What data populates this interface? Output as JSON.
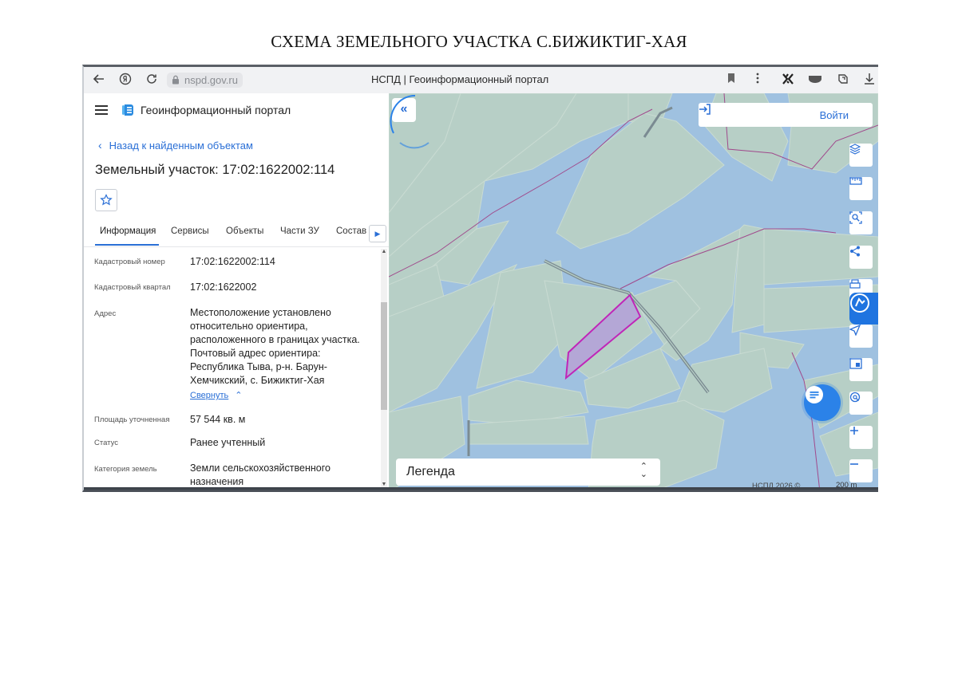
{
  "document": {
    "title": "СХЕМА ЗЕМЕЛЬНОГО УЧАСТКА С.БИЖИКТИГ-ХАЯ"
  },
  "browser": {
    "url": "nspd.gov.ru",
    "tab_title": "НСПД | Геоинформационный портал",
    "icons": [
      "back-arrow-icon",
      "yandex-icon",
      "reload-icon",
      "lock-icon",
      "bookmark-icon",
      "more-vert-icon",
      "extension-icon",
      "vpn-icon",
      "collections-icon",
      "download-icon"
    ]
  },
  "panel": {
    "portal_name": "Геоинформационный портал",
    "back_link": "Назад к найденным объектам",
    "parcel_title": "Земельный участок: 17:02:1622002:114",
    "tabs": [
      {
        "label": "Информация",
        "active": true
      },
      {
        "label": "Сервисы"
      },
      {
        "label": "Объекты"
      },
      {
        "label": "Части ЗУ"
      },
      {
        "label": "Состав"
      }
    ],
    "fields": {
      "cadastral_number": {
        "label": "Кадастровый номер",
        "value": "17:02:1622002:114"
      },
      "cadastral_quarter": {
        "label": "Кадастровый квартал",
        "value": "17:02:1622002"
      },
      "address": {
        "label": "Адрес",
        "value": "Местоположение установлено относительно ориентира, расположенного в границах участка. Почтовый адрес ориентира: Республика Тыва, р-н. Барун-Хемчикский, с. Бижиктиг-Хая"
      },
      "collapse_label": "Свернуть",
      "area": {
        "label": "Площадь уточненная",
        "value": "57 544 кв. м"
      },
      "status": {
        "label": "Статус",
        "value": "Ранее учтенный"
      },
      "land_category": {
        "label": "Категория земель",
        "value": "Земли сельскохозяйственного назначения"
      }
    }
  },
  "map": {
    "login_label": "Войти",
    "legend_label": "Легенда",
    "copyright": "НСПД 2026 ©",
    "scale_label": "200 m",
    "tools": [
      "layers-icon",
      "ruler-icon",
      "area-select-icon",
      "share-icon",
      "print-icon",
      "geolocation-icon",
      "minimap-icon",
      "search-location-icon",
      "zoom-in-icon",
      "zoom-out-icon"
    ],
    "colors": {
      "water": "#9fc1e0",
      "land": "#b7cfc6",
      "parcel_fill": "#b4a7d6",
      "parcel_stroke": "#c025b8",
      "boundary": "#a04a8c",
      "accent": "#2a6fd6"
    }
  }
}
